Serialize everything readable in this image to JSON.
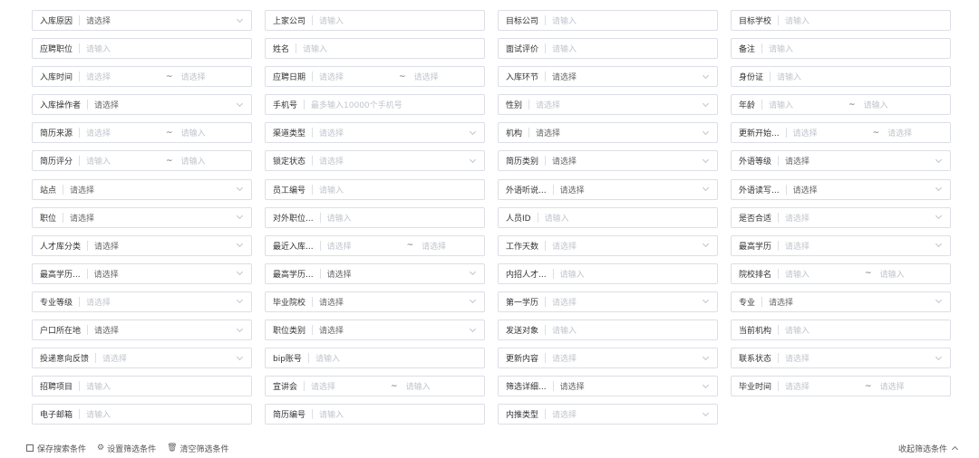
{
  "fields": [
    {
      "label": "入库原因",
      "value": "请选择",
      "dark": true,
      "type": "select"
    },
    {
      "label": "上家公司",
      "value": "请输入",
      "type": "input"
    },
    {
      "label": "目标公司",
      "value": "请输入",
      "type": "input"
    },
    {
      "label": "目标学校",
      "value": "请输入",
      "type": "input"
    },
    {
      "label": "应聘职位",
      "value": "请输入",
      "type": "input"
    },
    {
      "label": "姓名",
      "value": "请输入",
      "type": "input"
    },
    {
      "label": "面试评价",
      "value": "请输入",
      "type": "input"
    },
    {
      "label": "备注",
      "value": "请输入",
      "type": "input"
    },
    {
      "label": "入库时间",
      "value": "请选择",
      "value2": "请选择",
      "type": "range"
    },
    {
      "label": "应聘日期",
      "value": "请选择",
      "value2": "请选择",
      "type": "range"
    },
    {
      "label": "入库环节",
      "value": "请选择",
      "dark": true,
      "type": "select"
    },
    {
      "label": "身份证",
      "value": "请输入",
      "type": "input"
    },
    {
      "label": "入库操作者",
      "value": "请选择",
      "dark": true,
      "type": "select"
    },
    {
      "label": "手机号",
      "value": "最多输入10000个手机号",
      "type": "input"
    },
    {
      "label": "性别",
      "value": "请选择",
      "type": "select"
    },
    {
      "label": "年龄",
      "value": "请输入",
      "value2": "请输入",
      "type": "range"
    },
    {
      "label": "简历来源",
      "value": "请选择",
      "value2": "请输入",
      "type": "range"
    },
    {
      "label": "渠道类型",
      "value": "请选择",
      "type": "select"
    },
    {
      "label": "机构",
      "value": "请选择",
      "dark": true,
      "type": "select"
    },
    {
      "label": "更新开始...",
      "value": "请选择",
      "value2": "请选择",
      "type": "range"
    },
    {
      "label": "简历评分",
      "value": "请输入",
      "value2": "请输入",
      "type": "range"
    },
    {
      "label": "锁定状态",
      "value": "请选择",
      "type": "select"
    },
    {
      "label": "简历类别",
      "value": "请选择",
      "dark": true,
      "type": "select"
    },
    {
      "label": "外语等级",
      "value": "请选择",
      "dark": true,
      "type": "select"
    },
    {
      "label": "站点",
      "value": "请选择",
      "dark": true,
      "type": "select"
    },
    {
      "label": "员工编号",
      "value": "请输入",
      "type": "input"
    },
    {
      "label": "外语听说...",
      "value": "请选择",
      "dark": true,
      "type": "select"
    },
    {
      "label": "外语读写...",
      "value": "请选择",
      "dark": true,
      "type": "select"
    },
    {
      "label": "职位",
      "value": "请选择",
      "dark": true,
      "type": "select"
    },
    {
      "label": "对外职位...",
      "value": "请输入",
      "type": "input"
    },
    {
      "label": "人员ID",
      "value": "请输入",
      "type": "input"
    },
    {
      "label": "是否合适",
      "value": "请选择",
      "type": "select"
    },
    {
      "label": "人才库分类",
      "value": "请选择",
      "dark": true,
      "type": "select"
    },
    {
      "label": "最近入库...",
      "value": "请选择",
      "value2": "请选择",
      "type": "range"
    },
    {
      "label": "工作天数",
      "value": "请选择",
      "type": "select"
    },
    {
      "label": "最高学历",
      "value": "请选择",
      "type": "select"
    },
    {
      "label": "最高学历...",
      "value": "请选择",
      "dark": true,
      "type": "select"
    },
    {
      "label": "最高学历...",
      "value": "请选择",
      "dark": true,
      "type": "select"
    },
    {
      "label": "内招人才...",
      "value": "请输入",
      "type": "input"
    },
    {
      "label": "院校排名",
      "value": "请输入",
      "value2": "请输入",
      "type": "range"
    },
    {
      "label": "专业等级",
      "value": "请选择",
      "type": "select"
    },
    {
      "label": "毕业院校",
      "value": "请选择",
      "dark": true,
      "type": "select"
    },
    {
      "label": "第一学历",
      "value": "请选择",
      "type": "select"
    },
    {
      "label": "专业",
      "value": "请选择",
      "dark": true,
      "type": "select"
    },
    {
      "label": "户口所在地",
      "value": "请选择",
      "dark": true,
      "type": "select"
    },
    {
      "label": "职位类别",
      "value": "请选择",
      "dark": true,
      "type": "select"
    },
    {
      "label": "发送对象",
      "value": "请输入",
      "type": "input"
    },
    {
      "label": "当前机构",
      "value": "请输入",
      "type": "input"
    },
    {
      "label": "投递意向反馈",
      "value": "请选择",
      "type": "select"
    },
    {
      "label": "bip账号",
      "value": "请输入",
      "type": "input"
    },
    {
      "label": "更新内容",
      "value": "请选择",
      "type": "select"
    },
    {
      "label": "联系状态",
      "value": "请选择",
      "type": "select"
    },
    {
      "label": "招聘项目",
      "value": "请输入",
      "type": "input"
    },
    {
      "label": "宣讲会",
      "value": "请选择",
      "value2": "请输入",
      "type": "range"
    },
    {
      "label": "筛选详细...",
      "value": "请选择",
      "dark": true,
      "type": "select"
    },
    {
      "label": "毕业时间",
      "value": "请选择",
      "value2": "请选择",
      "type": "range"
    },
    {
      "label": "电子邮箱",
      "value": "请输入",
      "type": "input"
    },
    {
      "label": "简历编号",
      "value": "请输入",
      "type": "input"
    },
    {
      "label": "内推类型",
      "value": "请选择",
      "type": "select"
    }
  ],
  "footer": {
    "save_label": "保存搜索条件",
    "settings_label": "设置筛选条件",
    "clear_label": "清空筛选条件",
    "collapse_label": "收起筛选条件"
  },
  "icons": {
    "save": "save-icon",
    "settings": "settings-icon",
    "clear": "trash-icon",
    "collapse": "chevron-up-icon"
  },
  "colors": {
    "border": "#dcdfe6",
    "placeholder": "#c0c4cc",
    "text": "#333333"
  }
}
